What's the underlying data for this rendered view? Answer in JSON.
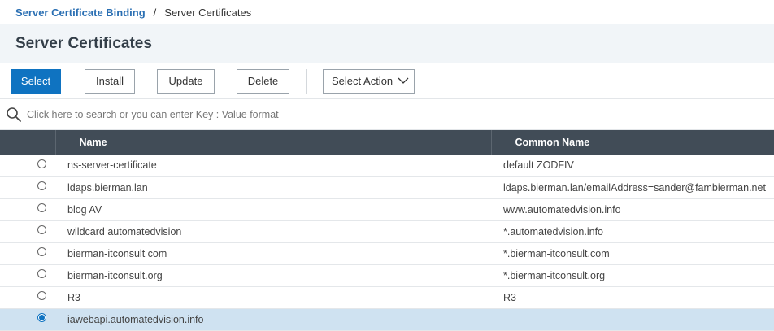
{
  "breadcrumb": {
    "parent": "Server Certificate Binding",
    "separator": "/",
    "current": "Server Certificates"
  },
  "page_title": "Server Certificates",
  "toolbar": {
    "select_label": "Select",
    "install_label": "Install",
    "update_label": "Update",
    "delete_label": "Delete",
    "action_label": "Select Action"
  },
  "search": {
    "placeholder": "Click here to search or you can enter Key : Value format",
    "value": ""
  },
  "table": {
    "columns": [
      "Name",
      "Common Name"
    ],
    "rows": [
      {
        "name": "ns-server-certificate",
        "common_name": "default ZODFIV",
        "selected": false
      },
      {
        "name": "ldaps.bierman.lan",
        "common_name": "ldaps.bierman.lan/emailAddress=sander@fambierman.net",
        "selected": false
      },
      {
        "name": "blog AV",
        "common_name": "www.automatedvision.info",
        "selected": false
      },
      {
        "name": "wildcard automatedvision",
        "common_name": "*.automatedvision.info",
        "selected": false
      },
      {
        "name": "bierman-itconsult com",
        "common_name": "*.bierman-itconsult.com",
        "selected": false
      },
      {
        "name": "bierman-itconsult.org",
        "common_name": "*.bierman-itconsult.org",
        "selected": false
      },
      {
        "name": "R3",
        "common_name": "R3",
        "selected": false
      },
      {
        "name": "iawebapi.automatedvision.info",
        "common_name": "--",
        "selected": true
      }
    ]
  },
  "colors": {
    "accent": "#0f73c1",
    "header_bg": "#414c57",
    "title_bar_bg": "#f1f5f8",
    "selected_row_bg": "#cfe2f1",
    "breadcrumb_link": "#2a6fb3"
  }
}
